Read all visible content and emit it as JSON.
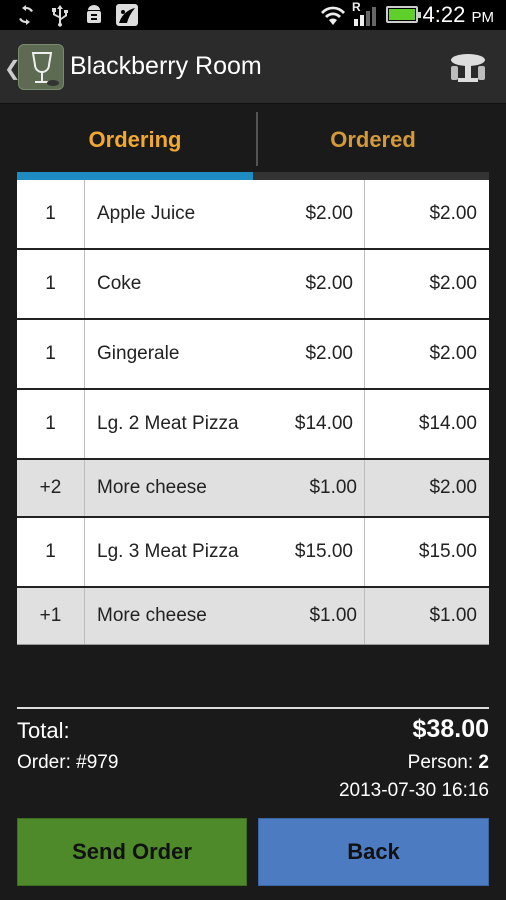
{
  "status_bar": {
    "time": "4:22",
    "ampm": "PM",
    "icons": [
      "sync-icon",
      "usb-icon",
      "android-debug-icon",
      "app-notification-icon",
      "wifi-icon",
      "signal-roaming-icon",
      "battery-icon"
    ],
    "roaming_letter": "R"
  },
  "action_bar": {
    "title": "Blackberry Room",
    "back_glyph": "❮"
  },
  "tabs": [
    {
      "label": "Ordering",
      "selected": true
    },
    {
      "label": "Ordered",
      "selected": false
    }
  ],
  "table": {
    "rows": [
      {
        "qty": "1",
        "name": "Apple Juice",
        "price": "$2.00",
        "total": "$2.00",
        "sub": false
      },
      {
        "qty": "1",
        "name": "Coke",
        "price": "$2.00",
        "total": "$2.00",
        "sub": false
      },
      {
        "qty": "1",
        "name": "Gingerale",
        "price": "$2.00",
        "total": "$2.00",
        "sub": false
      },
      {
        "qty": "1",
        "name": "Lg. 2 Meat Pizza",
        "price": "$14.00",
        "total": "$14.00",
        "sub": false
      },
      {
        "qty": "+2",
        "name": "More cheese",
        "price": "$1.00",
        "total": "$2.00",
        "sub": true
      },
      {
        "qty": "1",
        "name": "Lg. 3 Meat Pizza",
        "price": "$15.00",
        "total": "$15.00",
        "sub": false
      },
      {
        "qty": "+1",
        "name": "More cheese",
        "price": "$1.00",
        "total": "$1.00",
        "sub": true
      }
    ]
  },
  "summary": {
    "total_label": "Total:",
    "total_value": "$38.00",
    "order_label": "Order: #979",
    "person_label": "Person:",
    "person_value": "2",
    "datetime": "2013-07-30 16:16"
  },
  "buttons": {
    "send": "Send Order",
    "back": "Back"
  },
  "colors": {
    "tab_selected": "#f0a830",
    "tab_indicator": "#1e8bc3",
    "send_button": "#4f8a2a",
    "back_button": "#4d7bc2"
  }
}
